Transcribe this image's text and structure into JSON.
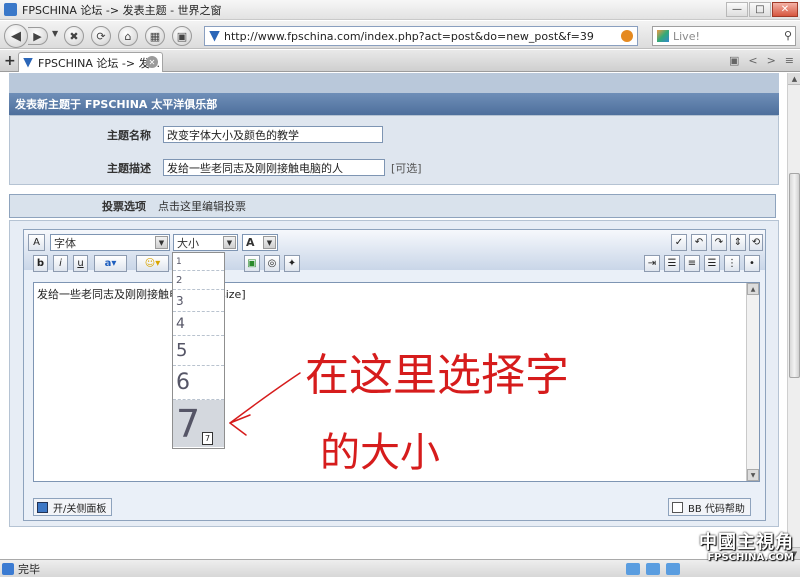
{
  "window": {
    "title": "FPSCHINA 论坛 -> 发表主题 - 世界之窗",
    "minimize": "—",
    "maximize": "□",
    "close": "✕"
  },
  "nav": {
    "url": "http://www.fpschina.com/index.php?act=post&do=new_post&f=39",
    "search_placeholder": "Live!",
    "back": "◀",
    "forward": "▶",
    "dropdown": "▼",
    "stop": "✖",
    "refresh": "⟳",
    "home": "⌂",
    "grid": "▦",
    "view": "▣",
    "search_icon": "⚲"
  },
  "tabs": [
    {
      "label": "FPSCHINA 论坛 -> 发..."
    }
  ],
  "tabbar_tools": {
    "new_tab": "+",
    "menu": "▣",
    "prev": "<",
    "next": ">",
    "list": "≡"
  },
  "forum": {
    "header": "发表新主题于 FPSCHINA 太平洋俱乐部",
    "topic_title_label": "主题名称",
    "topic_title_value": "改变字体大小及颜色的教学",
    "topic_desc_label": "主题描述",
    "topic_desc_value": "发给一些老同志及刚刚接触电脑的人",
    "optional": "[可选]",
    "poll_label": "投票选项",
    "poll_link": "点击这里编辑投票"
  },
  "editor": {
    "font_select": "字体",
    "size_select": "大小",
    "color_select": "A",
    "bold": "b",
    "italic": "i",
    "underline": "u",
    "content_left": "发给一些老同志及刚刚接触电脑的",
    "content_right": "[/size]",
    "size_options": [
      "1",
      "2",
      "3",
      "4",
      "5",
      "6",
      "7"
    ],
    "selected_size": "7",
    "tooltip": "7",
    "toggle_panel": "开/关侧面板",
    "bb_help": "BB 代码帮助"
  },
  "annotation": {
    "line1": "在这里选择字",
    "line2": "的大小"
  },
  "status": {
    "text": "完毕"
  },
  "watermark": {
    "cn": "中國主視角",
    "en": "FPSCHINA.COM"
  },
  "colors": {
    "annotation": "#d61c1c",
    "header": "#5a7aa8",
    "panel": "#dfe6ef"
  }
}
